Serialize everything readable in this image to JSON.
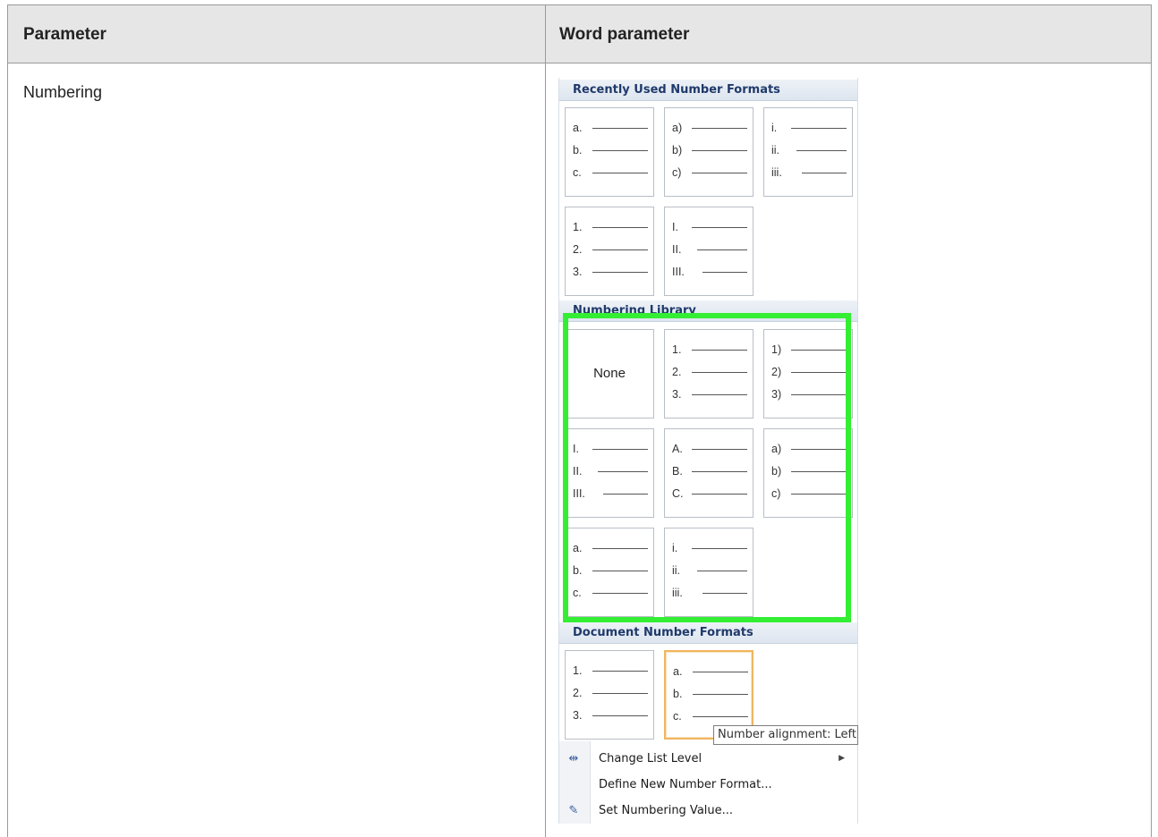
{
  "table": {
    "header": {
      "col1": "Parameter",
      "col2": "Word parameter"
    },
    "row": {
      "parameter": "Numbering"
    }
  },
  "menu": {
    "sections": {
      "recent": "Recently Used Number Formats",
      "library": "Numbering Library",
      "document": "Document Number Formats"
    },
    "recent_tiles": [
      [
        "a.",
        "b.",
        "c."
      ],
      [
        "a)",
        "b)",
        "c)"
      ],
      [
        "i.",
        "ii.",
        "iii."
      ],
      [
        "1.",
        "2.",
        "3."
      ],
      [
        "I.",
        "II.",
        "III."
      ]
    ],
    "library_none": "None",
    "library_tiles": [
      [
        "1.",
        "2.",
        "3."
      ],
      [
        "1)",
        "2)",
        "3)"
      ],
      [
        "I.",
        "II.",
        "III."
      ],
      [
        "A.",
        "B.",
        "C."
      ],
      [
        "a)",
        "b)",
        "c)"
      ],
      [
        "a.",
        "b.",
        "c."
      ],
      [
        "i.",
        "ii.",
        "iii."
      ]
    ],
    "document_tiles": [
      [
        "1.",
        "2.",
        "3."
      ],
      [
        "a.",
        "b.",
        "c."
      ]
    ],
    "tooltip": "Number alignment: Left",
    "commands": {
      "change_level": "Change List Level",
      "define_new": "Define New Number Format...",
      "set_value": "Set Numbering Value..."
    },
    "highlight_color": "#33ee33",
    "selected_border_color": "#f0b560"
  }
}
